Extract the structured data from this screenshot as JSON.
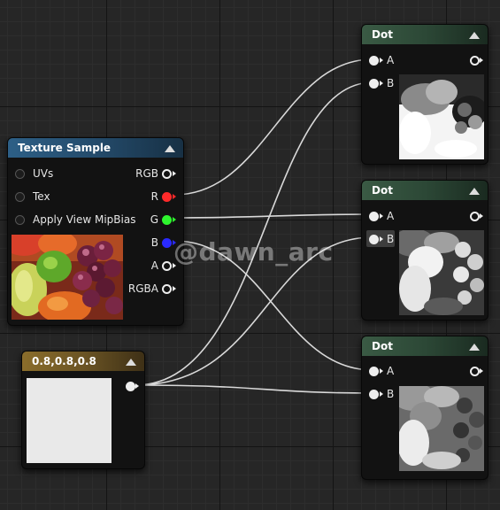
{
  "texture_node": {
    "title": "Texture Sample",
    "inputs": [
      "UVs",
      "Tex",
      "Apply View MipBias"
    ],
    "outputs": [
      "RGB",
      "R",
      "G",
      "B",
      "A",
      "RGBA"
    ],
    "output_colors": {
      "R": "#ff2a2a",
      "G": "#2ef52e",
      "B": "#2a2aff"
    }
  },
  "constant_node": {
    "title": "0.8,0.8,0.8",
    "swatch_color": "#e9e9e9"
  },
  "dot_nodes": [
    {
      "title": "Dot",
      "input_a": "A",
      "input_b": "B"
    },
    {
      "title": "Dot",
      "input_a": "A",
      "input_b": "B"
    },
    {
      "title": "Dot",
      "input_a": "A",
      "input_b": "B"
    }
  ],
  "watermark": "@dawn_arc"
}
